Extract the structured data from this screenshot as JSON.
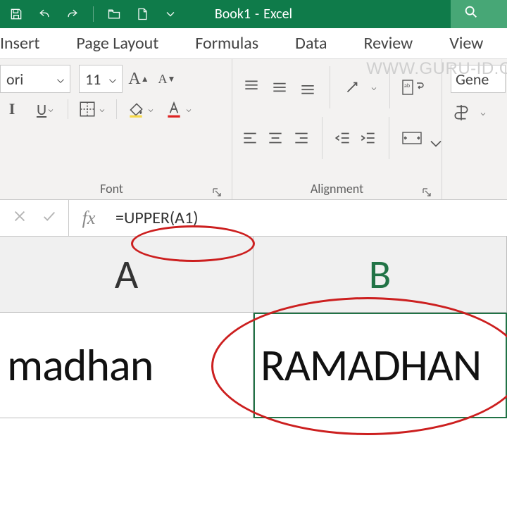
{
  "title": {
    "doc": "Book1",
    "sep": "-",
    "app": "Excel"
  },
  "watermark": "WWW.GURU-ID.O",
  "tabs": {
    "insert": "Insert",
    "page_layout": "Page Layout",
    "formulas": "Formulas",
    "data": "Data",
    "review": "Review",
    "view": "View"
  },
  "font": {
    "name": "ori",
    "size": "11",
    "group_label": "Font",
    "bold": "I",
    "underline": "U"
  },
  "alignment": {
    "group_label": "Alignment"
  },
  "number": {
    "format": "Gene"
  },
  "formula_bar": {
    "fx": "fx",
    "value": "=UPPER(A1)"
  },
  "columns": {
    "A": "A",
    "B": "B"
  },
  "cells": {
    "A1": "madhan",
    "B1": "RAMADHAN"
  }
}
